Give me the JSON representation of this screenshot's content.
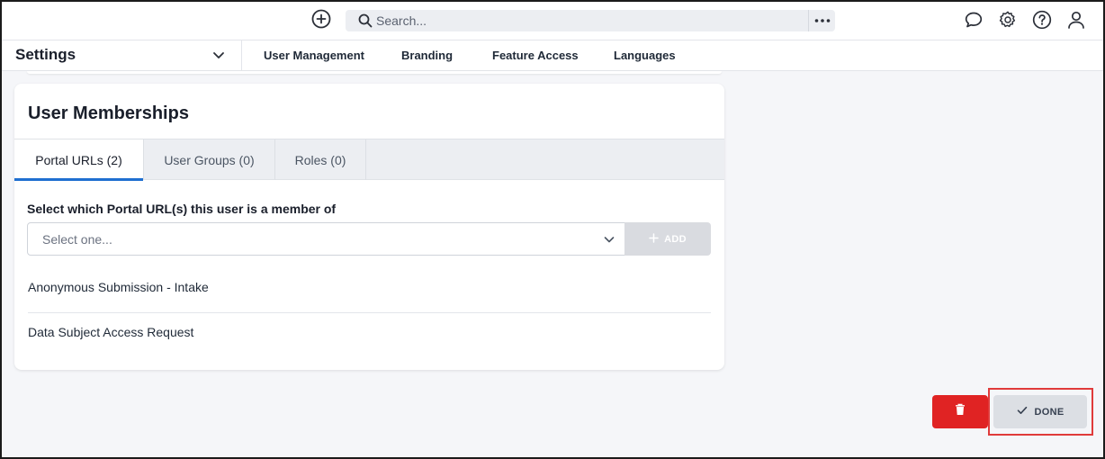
{
  "topbar": {
    "search_placeholder": "Search...",
    "icons": [
      "add-circle-icon",
      "search-icon",
      "more-icon",
      "chat-icon",
      "gear-icon",
      "help-icon",
      "user-icon"
    ]
  },
  "subnav": {
    "title": "Settings",
    "tabs": [
      {
        "label": "User Management",
        "active": true
      },
      {
        "label": "Branding",
        "active": false
      },
      {
        "label": "Feature Access",
        "active": false
      },
      {
        "label": "Languages",
        "active": false
      }
    ]
  },
  "card": {
    "title": "User Memberships",
    "tabs": [
      {
        "label": "Portal URLs (2)",
        "active": true
      },
      {
        "label": "User Groups (0)",
        "active": false
      },
      {
        "label": "Roles (0)",
        "active": false
      }
    ],
    "field_label": "Select which Portal URL(s) this user is a member of",
    "select_placeholder": "Select one...",
    "add_label": "ADD",
    "items": [
      "Anonymous Submission - Intake",
      "Data Subject Access Request"
    ]
  },
  "footer": {
    "done_label": "DONE"
  },
  "colors": {
    "accent": "#1f6fd0",
    "danger": "#e02323",
    "highlight": "#e03b3b"
  }
}
